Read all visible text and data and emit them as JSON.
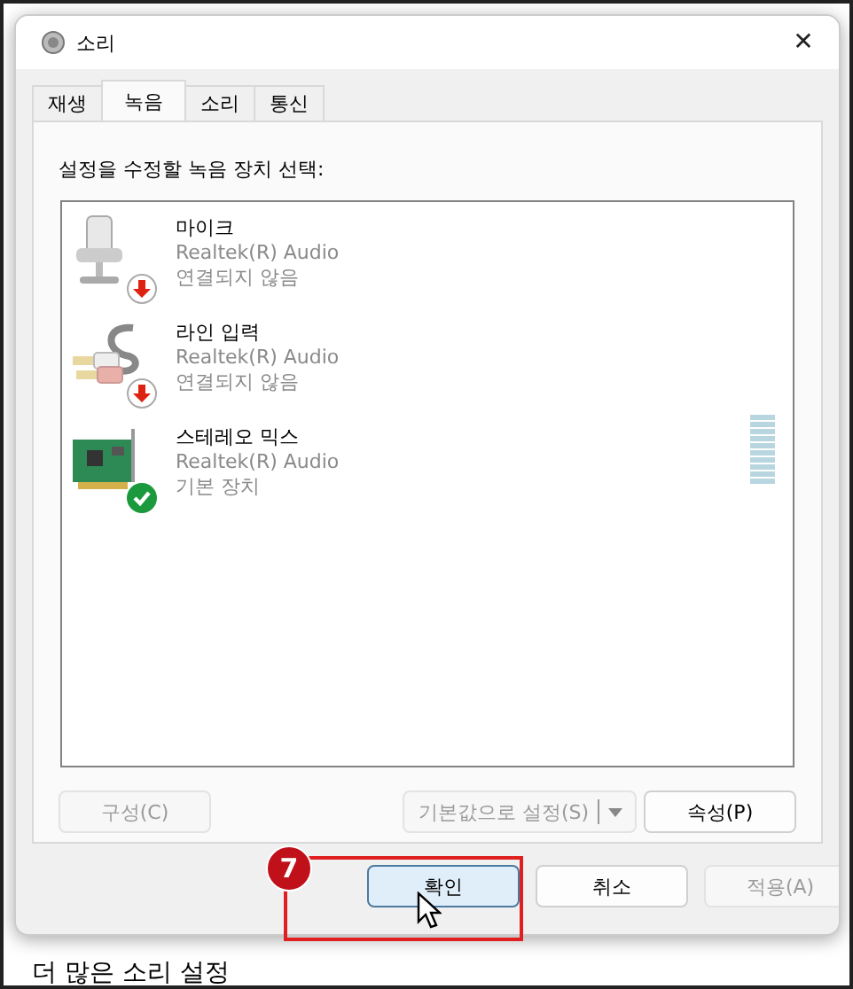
{
  "window": {
    "title": "소리",
    "close": "✕"
  },
  "tabs": [
    {
      "label": "재생",
      "selected": false
    },
    {
      "label": "녹음",
      "selected": true
    },
    {
      "label": "소리",
      "selected": false
    },
    {
      "label": "통신",
      "selected": false
    }
  ],
  "instruction": "설정을 수정할 녹음 장치 선택:",
  "devices": [
    {
      "kind": "microphone",
      "name": "마이크",
      "driver": "Realtek(R) Audio",
      "status": "연결되지 않음",
      "connected": false
    },
    {
      "kind": "line-in",
      "name": "라인 입력",
      "driver": "Realtek(R) Audio",
      "status": "연결되지 않음",
      "connected": false
    },
    {
      "kind": "sound-card",
      "name": "스테레오 믹스",
      "driver": "Realtek(R) Audio",
      "status": "기본 장치",
      "connected": true,
      "default": true
    }
  ],
  "panel_buttons": {
    "configure": {
      "label": "구성(C)",
      "disabled": true
    },
    "set_default": {
      "label": "기본값으로 설정(S)",
      "disabled": true
    },
    "properties": {
      "label": "속성(P)",
      "disabled": false
    }
  },
  "dialog_buttons": [
    {
      "label": "확인",
      "disabled": false,
      "focused": true
    },
    {
      "label": "취소",
      "disabled": false,
      "focused": false
    },
    {
      "label": "적용(A)",
      "disabled": true,
      "focused": false
    }
  ],
  "annotation": {
    "step": "7"
  },
  "background_text": "더 많은 소리 설정"
}
